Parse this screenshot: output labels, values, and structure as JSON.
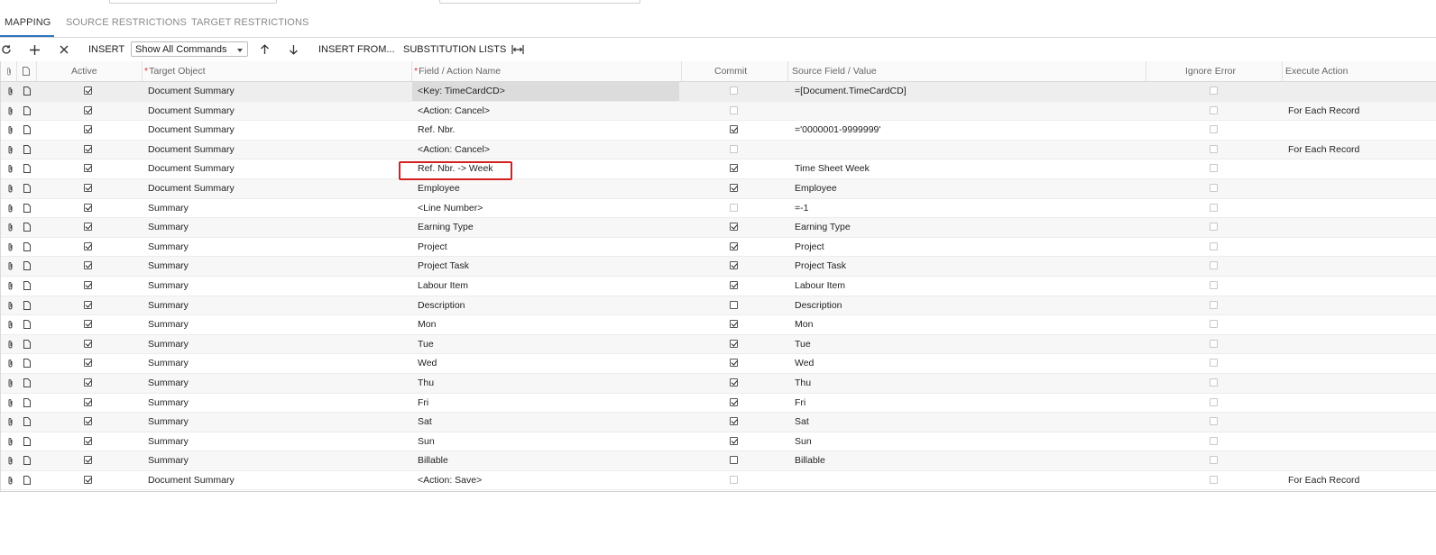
{
  "tabs": [
    {
      "label": "MAPPING",
      "active": true
    },
    {
      "label": "SOURCE RESTRICTIONS",
      "active": false
    },
    {
      "label": "TARGET RESTRICTIONS",
      "active": false
    }
  ],
  "toolbar": {
    "refresh_icon": "refresh-icon",
    "add_icon": "plus-icon",
    "delete_icon": "close-icon",
    "insert_label": "INSERT",
    "command_filter_value": "Show All Commands",
    "move_up_icon": "arrow-up-icon",
    "move_down_icon": "arrow-down-icon",
    "insert_from_label": "INSERT FROM...",
    "substitution_lists_label": "SUBSTITUTION LISTS",
    "fit_columns_icon": "fit-width-icon"
  },
  "columns": {
    "active": "Active",
    "target_object": "Target Object",
    "field_action": "Field / Action Name",
    "commit": "Commit",
    "source_field": "Source Field / Value",
    "ignore_error": "Ignore Error",
    "execute_action": "Execute Action",
    "required_marker": "*"
  },
  "colors": {
    "highlight_box": "#d61f1f",
    "active_tab_underline": "#2f74c0"
  },
  "rows": [
    {
      "active": true,
      "target": "Document Summary",
      "field": "<Key: TimeCardCD>",
      "commit": false,
      "commit_enabled": false,
      "source": "=[Document.TimeCardCD]",
      "ignore": false,
      "execute": ""
    },
    {
      "active": true,
      "target": "Document Summary",
      "field": "<Action: Cancel>",
      "commit": false,
      "commit_enabled": false,
      "source": "",
      "ignore": false,
      "execute": "For Each Record"
    },
    {
      "active": true,
      "target": "Document Summary",
      "field": "Ref. Nbr.",
      "commit": true,
      "commit_enabled": true,
      "source": "='0000001-9999999'",
      "ignore": false,
      "execute": ""
    },
    {
      "active": true,
      "target": "Document Summary",
      "field": "<Action: Cancel>",
      "commit": false,
      "commit_enabled": false,
      "source": "",
      "ignore": false,
      "execute": "For Each Record"
    },
    {
      "active": true,
      "target": "Document Summary",
      "field": "Ref. Nbr. -> Week",
      "commit": true,
      "commit_enabled": true,
      "source": "Time Sheet Week",
      "ignore": false,
      "execute": ""
    },
    {
      "active": true,
      "target": "Document Summary",
      "field": "Employee",
      "commit": true,
      "commit_enabled": true,
      "source": "Employee",
      "ignore": false,
      "execute": ""
    },
    {
      "active": true,
      "target": "Summary",
      "field": "<Line Number>",
      "commit": false,
      "commit_enabled": false,
      "source": "=-1",
      "ignore": false,
      "execute": ""
    },
    {
      "active": true,
      "target": "Summary",
      "field": "Earning Type",
      "commit": true,
      "commit_enabled": true,
      "source": "Earning Type",
      "ignore": false,
      "execute": ""
    },
    {
      "active": true,
      "target": "Summary",
      "field": "Project",
      "commit": true,
      "commit_enabled": true,
      "source": "Project",
      "ignore": false,
      "execute": ""
    },
    {
      "active": true,
      "target": "Summary",
      "field": "Project Task",
      "commit": true,
      "commit_enabled": true,
      "source": "Project Task",
      "ignore": false,
      "execute": ""
    },
    {
      "active": true,
      "target": "Summary",
      "field": "Labour Item",
      "commit": true,
      "commit_enabled": true,
      "source": "Labour Item",
      "ignore": false,
      "execute": ""
    },
    {
      "active": true,
      "target": "Summary",
      "field": "Description",
      "commit": false,
      "commit_enabled": true,
      "source": "Description",
      "ignore": false,
      "execute": ""
    },
    {
      "active": true,
      "target": "Summary",
      "field": "Mon",
      "commit": true,
      "commit_enabled": true,
      "source": "Mon",
      "ignore": false,
      "execute": ""
    },
    {
      "active": true,
      "target": "Summary",
      "field": "Tue",
      "commit": true,
      "commit_enabled": true,
      "source": "Tue",
      "ignore": false,
      "execute": ""
    },
    {
      "active": true,
      "target": "Summary",
      "field": "Wed",
      "commit": true,
      "commit_enabled": true,
      "source": "Wed",
      "ignore": false,
      "execute": ""
    },
    {
      "active": true,
      "target": "Summary",
      "field": "Thu",
      "commit": true,
      "commit_enabled": true,
      "source": "Thu",
      "ignore": false,
      "execute": ""
    },
    {
      "active": true,
      "target": "Summary",
      "field": "Fri",
      "commit": true,
      "commit_enabled": true,
      "source": "Fri",
      "ignore": false,
      "execute": ""
    },
    {
      "active": true,
      "target": "Summary",
      "field": "Sat",
      "commit": true,
      "commit_enabled": true,
      "source": "Sat",
      "ignore": false,
      "execute": ""
    },
    {
      "active": true,
      "target": "Summary",
      "field": "Sun",
      "commit": true,
      "commit_enabled": true,
      "source": "Sun",
      "ignore": false,
      "execute": ""
    },
    {
      "active": true,
      "target": "Summary",
      "field": "Billable",
      "commit": false,
      "commit_enabled": true,
      "source": "Billable",
      "ignore": false,
      "execute": ""
    },
    {
      "active": true,
      "target": "Document Summary",
      "field": "<Action: Save>",
      "commit": false,
      "commit_enabled": false,
      "source": "",
      "ignore": false,
      "execute": "For Each Record"
    }
  ]
}
